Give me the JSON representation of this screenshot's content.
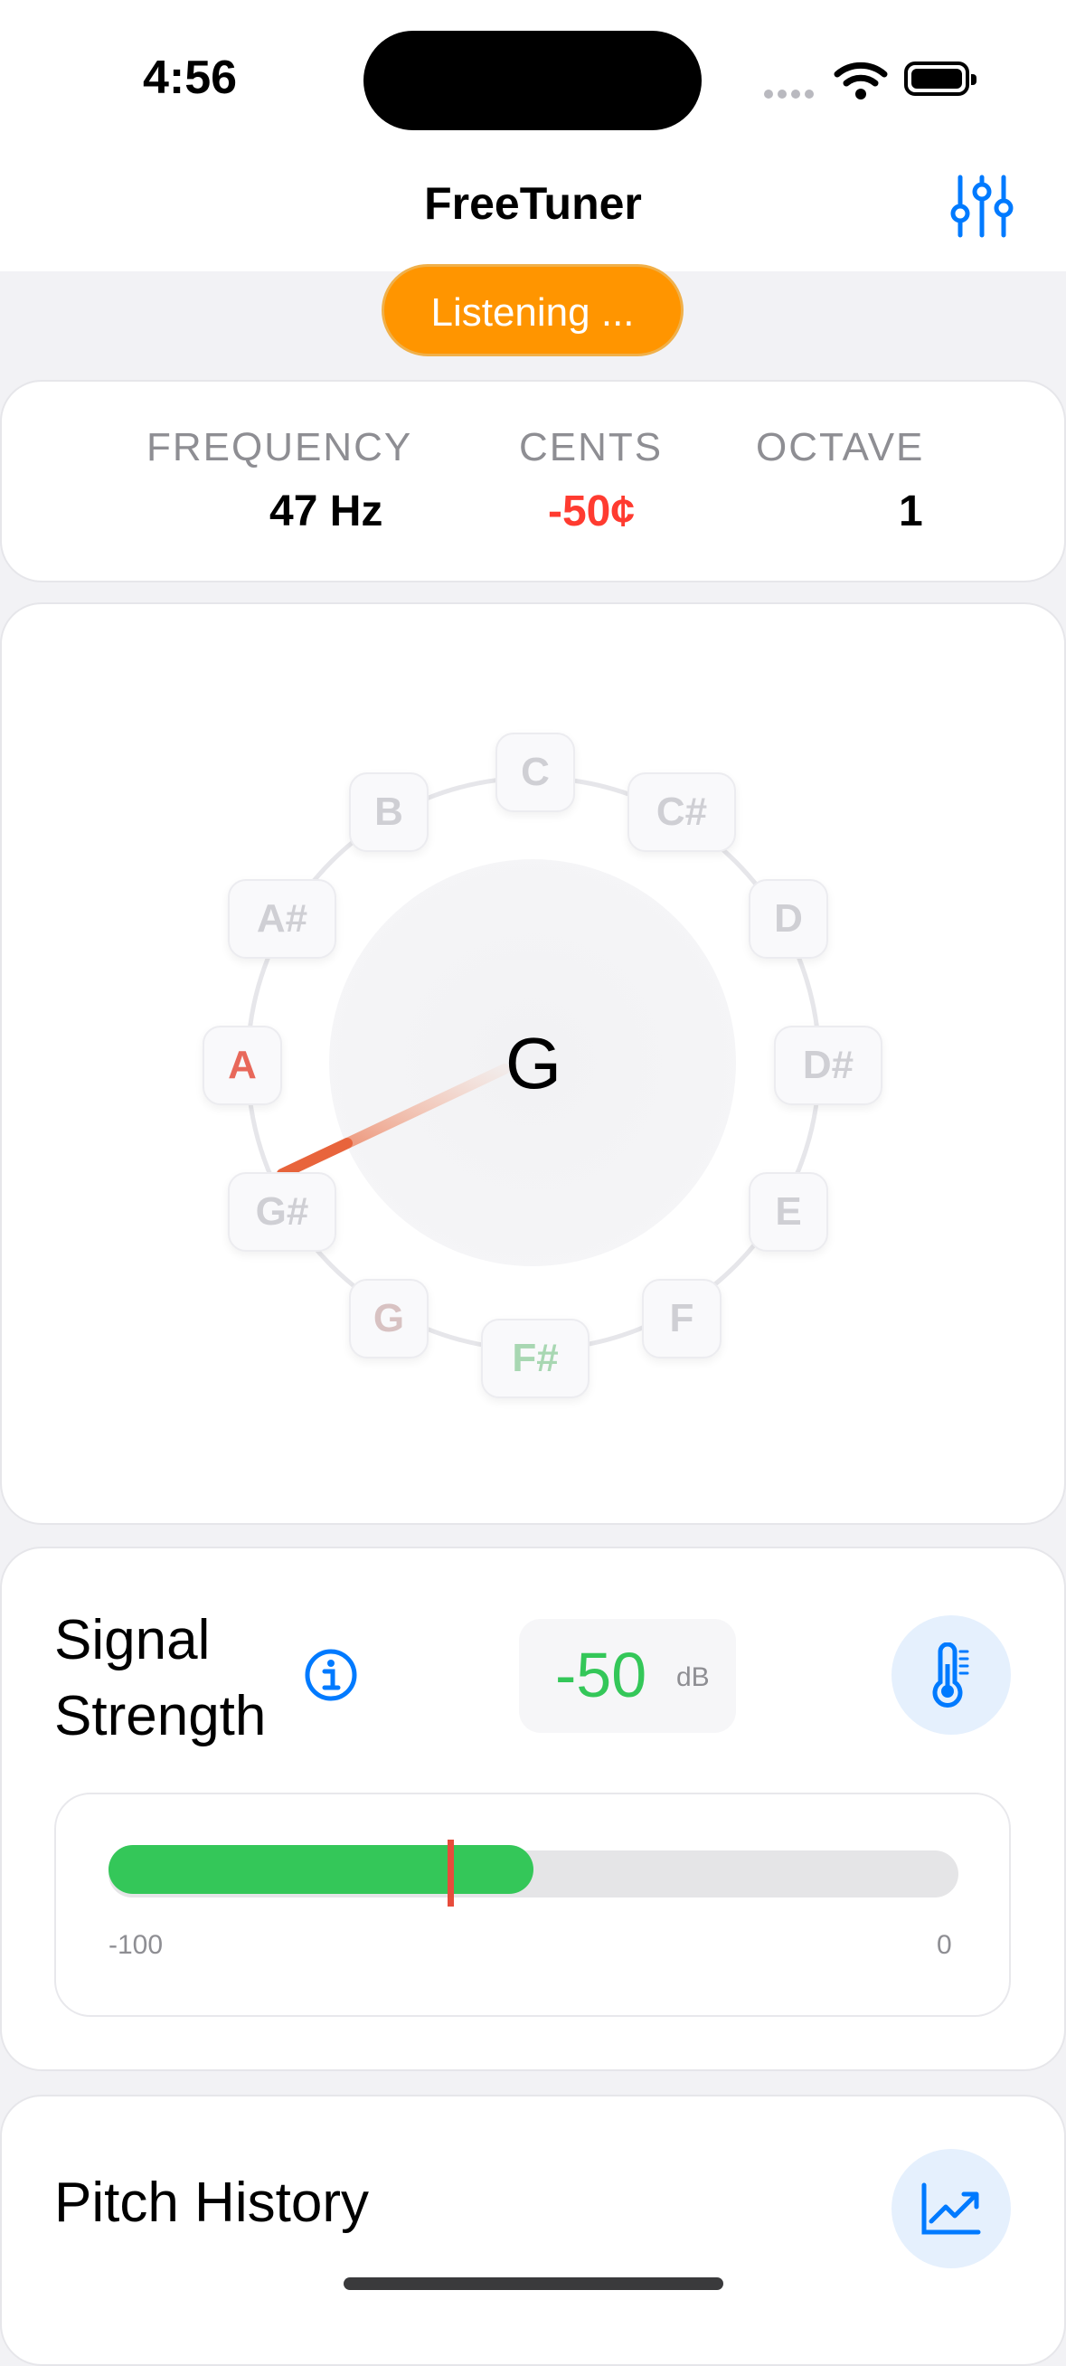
{
  "status_bar": {
    "time": "4:56"
  },
  "nav": {
    "title": "FreeTuner"
  },
  "status_pill": {
    "label": "Listening ..."
  },
  "readout": {
    "frequency_label": "FREQUENCY",
    "frequency_value": "47 Hz",
    "cents_label": "CENTS",
    "cents_value": "-50¢",
    "octave_label": "OCTAVE",
    "octave_value": "1"
  },
  "wheel": {
    "center_note": "G",
    "notes": [
      "C",
      "C#",
      "D",
      "D#",
      "E",
      "F",
      "F#",
      "G",
      "G#",
      "A",
      "A#",
      "B"
    ],
    "highlight_flat": "A",
    "highlight_sharp": "F#",
    "needle_color": "#e8643c"
  },
  "signal": {
    "title_line1": "Signal",
    "title_line2": "Strength",
    "db_value": "-50",
    "db_unit": "dB",
    "scale_min": "-100",
    "scale_max": "0",
    "level_fraction": 0.5,
    "fill_color": "#34c759"
  },
  "history": {
    "title": "Pitch History"
  },
  "colors": {
    "accent": "#007aff",
    "listening": "#ff9500",
    "negative": "#ff3b30",
    "positive": "#34c759"
  }
}
